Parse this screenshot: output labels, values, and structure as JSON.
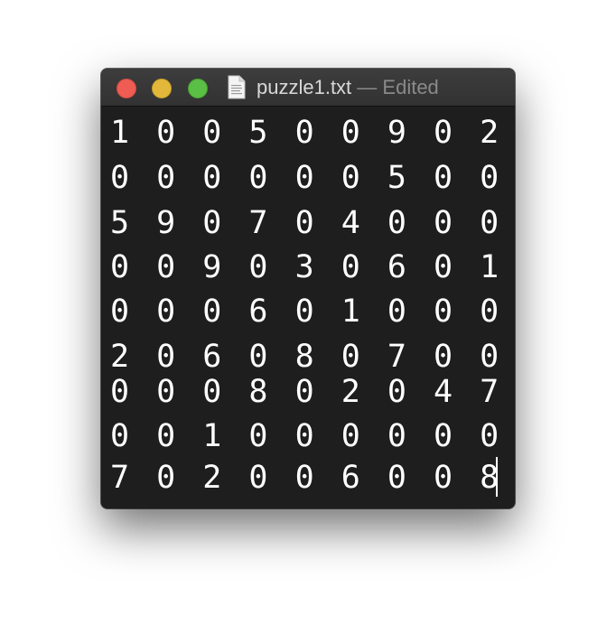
{
  "window": {
    "file_name": "puzzle1.txt",
    "separator": " — ",
    "state": "Edited"
  },
  "icons": {
    "close": "close-button",
    "minimize": "minimize-button",
    "zoom": "zoom-button",
    "document": "document-icon"
  },
  "colors": {
    "close": "#ee5c54",
    "minimize": "#e3b83a",
    "zoom": "#5bbe45",
    "editor_background": "#1e1e1e",
    "text": "#ffffff"
  },
  "editor": {
    "lines": [
      "1 0 0 5 0 0 9 0 2",
      "0 0 0 0 0 0 5 0 0",
      "5 9 0 7 0 4 0 0 0",
      "0 0 9 0 3 0 6 0 1",
      "0 0 0 6 0 1 0 0 0",
      "2 0 6 0 8 0 7 0 0",
      "0 0 0 8 0 2 0 4 7",
      "0 0 1 0 0 0 0 0 0",
      "7 0 2 0 0 6 0 0 8"
    ]
  }
}
